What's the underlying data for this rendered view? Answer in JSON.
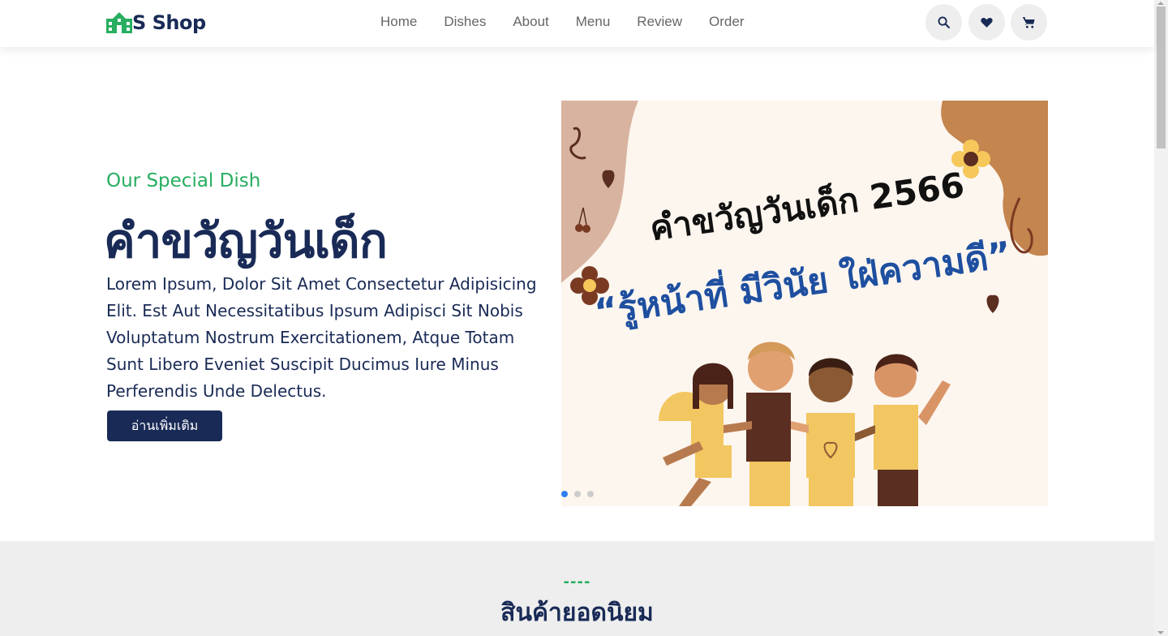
{
  "header": {
    "logo_text": "S Shop",
    "logo_icon": "school-building-icon",
    "nav": [
      "Home",
      "Dishes",
      "About",
      "Menu",
      "Review",
      "Order"
    ],
    "icons": [
      "search-icon",
      "heart-icon",
      "cart-icon"
    ]
  },
  "hero": {
    "subtitle": "Our Special Dish",
    "title": "คำขวัญวันเด็ก",
    "description": "Lorem Ipsum, Dolor Sit Amet Consectetur Adipisicing Elit. Est Aut Necessitatibus Ipsum Adipisci Sit Nobis Voluptatum Nostrum Exercitationem, Atque Totam Sunt Libero Eveniet Suscipit Ducimus Iure Minus Perferendis Unde Delectus.",
    "button_label": "อ่านเพิ่มเติม"
  },
  "slide": {
    "headline": "คำขวัญวันเด็ก 2566",
    "motto": "“รู้หน้าที่ มีวินัย ใฝ่ความดี”",
    "active_index": 0,
    "count": 3
  },
  "section": {
    "dash": "----",
    "title": "สินค้ายอดนิยม"
  },
  "colors": {
    "brand_dark": "#192a56",
    "accent_green": "#27ae60",
    "active_dot": "#2f7ff0"
  }
}
